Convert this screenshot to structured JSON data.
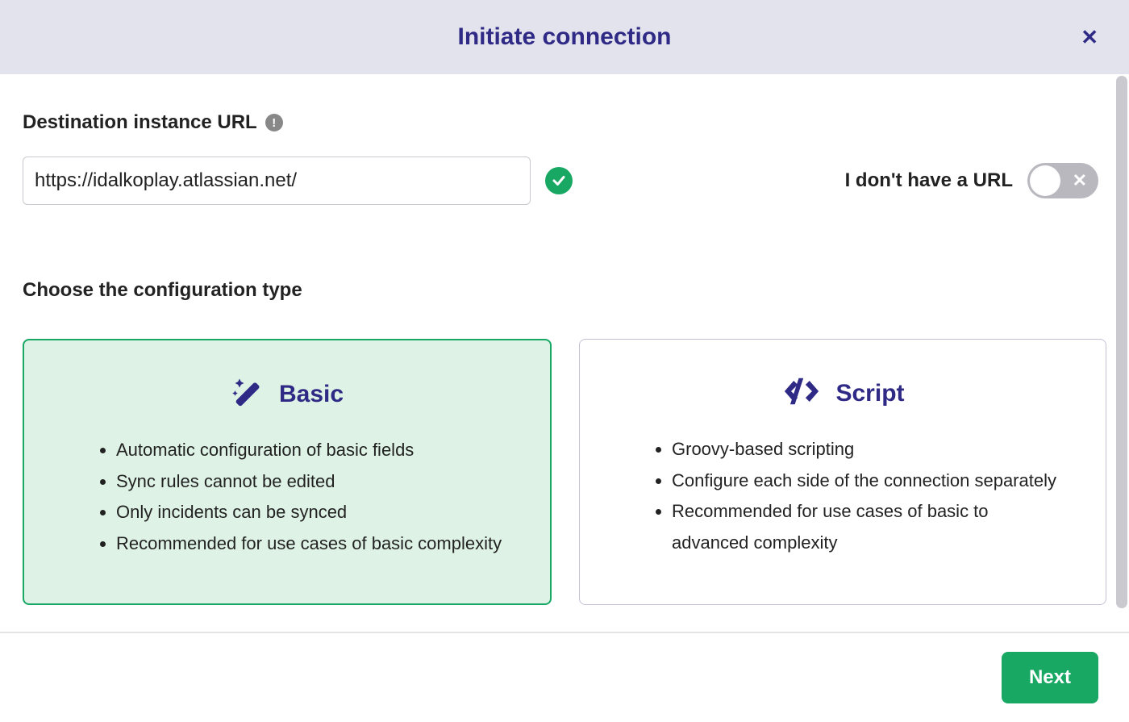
{
  "header": {
    "title": "Initiate connection"
  },
  "form": {
    "url_label": "Destination instance URL",
    "url_value": "https://idalkoplay.atlassian.net/",
    "no_url_label": "I don't have a URL",
    "no_url_toggle_on": false
  },
  "config": {
    "section_label": "Choose the configuration type",
    "options": [
      {
        "key": "basic",
        "title": "Basic",
        "selected": true,
        "bullets": [
          "Automatic configuration of basic fields",
          "Sync rules cannot be edited",
          "Only incidents can be synced",
          "Recommended for use cases of basic complexity"
        ]
      },
      {
        "key": "script",
        "title": "Script",
        "selected": false,
        "bullets": [
          "Groovy-based scripting",
          "Configure each side of the connection separately",
          "Recommended for use cases of basic to advanced complexity"
        ]
      }
    ]
  },
  "footer": {
    "next_label": "Next"
  }
}
